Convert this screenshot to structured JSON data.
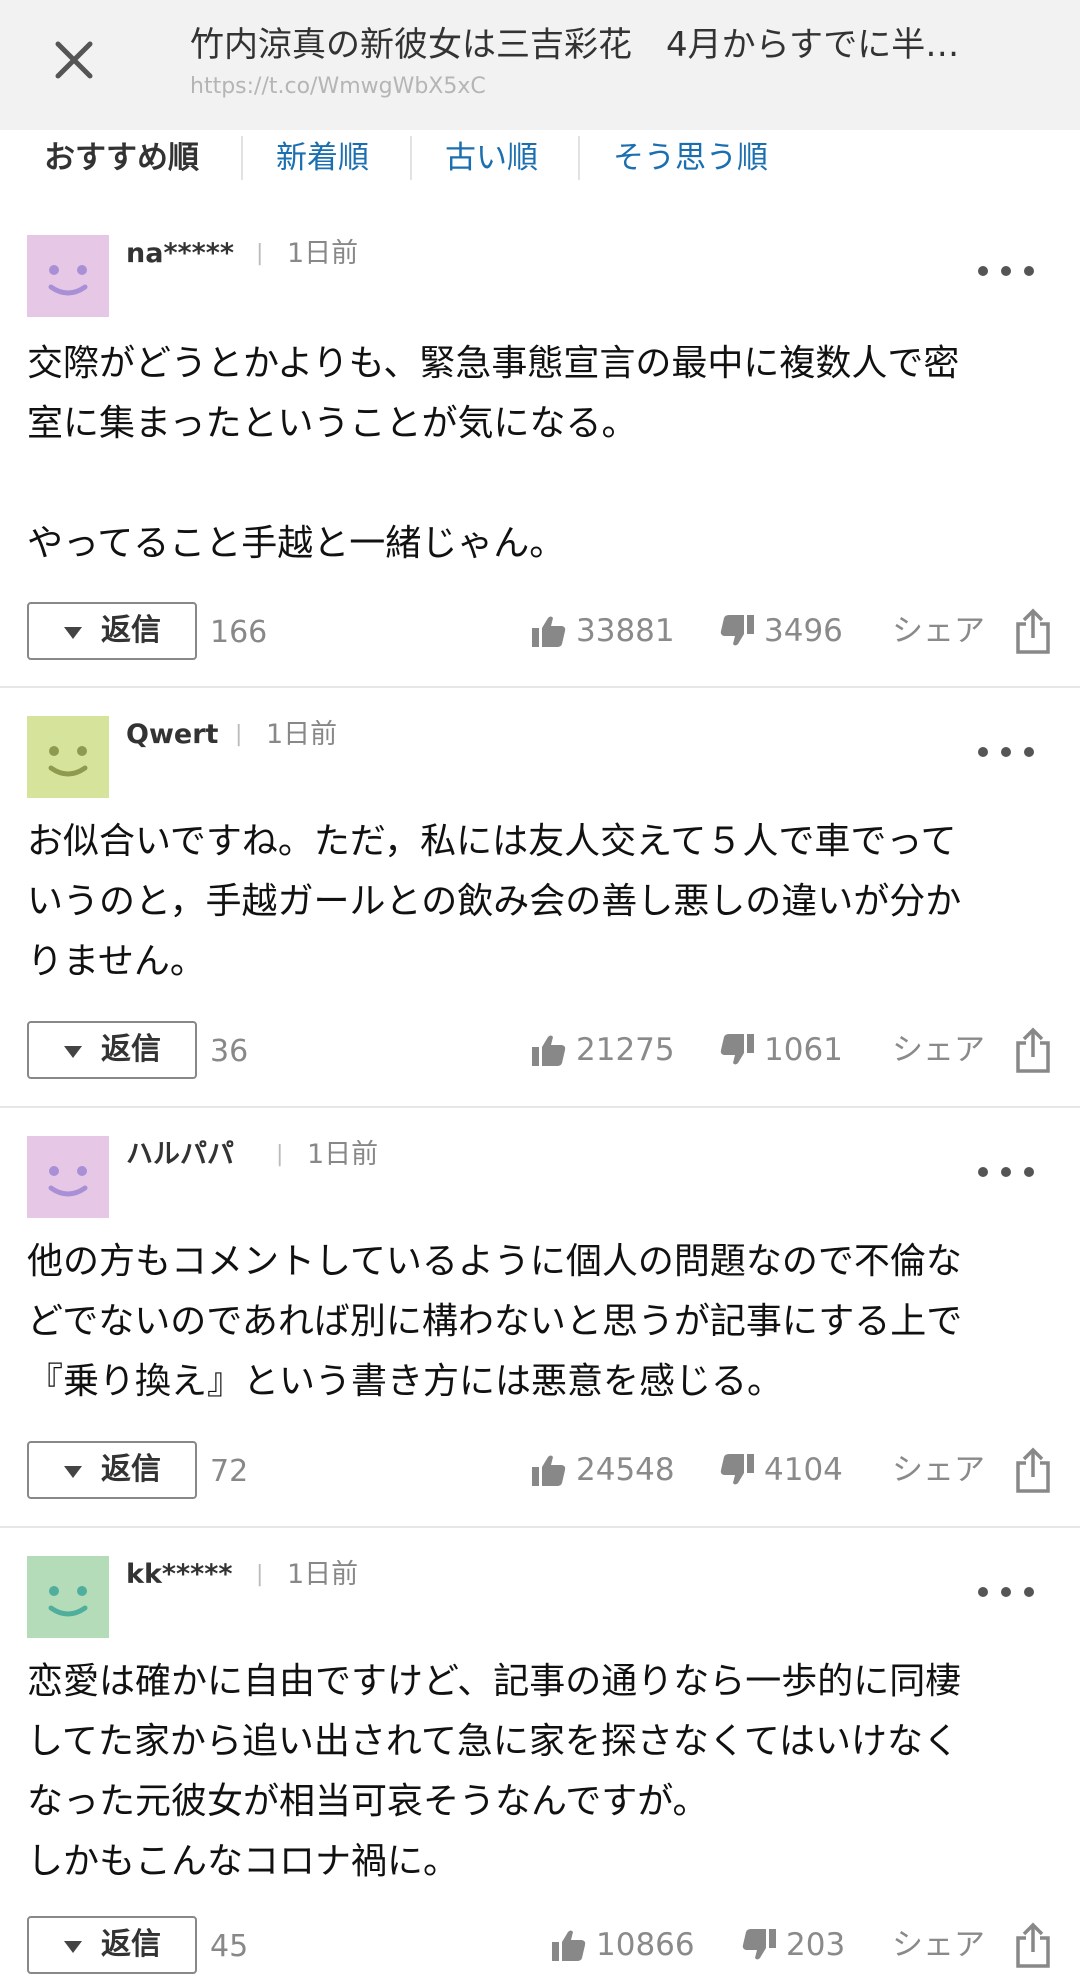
{
  "header": {
    "title": "竹内涼真の新彼女は三吉彩花　4月からすでに半…",
    "url": "https://t.co/WmwgWbX5xC"
  },
  "tabs": [
    {
      "label": "おすすめ順",
      "active": true
    },
    {
      "label": "新着順",
      "active": false
    },
    {
      "label": "古い順",
      "active": false
    },
    {
      "label": "そう思う順",
      "active": false
    }
  ],
  "reply_label": "返信",
  "share_label": "シェア",
  "colors": {
    "accent_link": "#1b6fb0",
    "avatar_purple": "#e6c8e6",
    "avatar_green_yellow": "#d6e39a",
    "avatar_mint": "#b5dcb9"
  },
  "comments": [
    {
      "user": "na*****",
      "time": "1日前",
      "avatar_color": "#e6c8e6",
      "avatar_face": "#a98fd6",
      "body": "交際がどうとかよりも、緊急事態宣言の最中に複数人で密\n室に集まったということが気になる。\n\nやってること手越と一緒じゃん。",
      "reply_count": "166",
      "likes": "33881",
      "dislikes": "3496"
    },
    {
      "user": "Qwert",
      "time": "1日前",
      "avatar_color": "#d6e39a",
      "avatar_face": "#8e9a50",
      "body": "お似合いですね。ただ，私には友人交えて５人で車でって\nいうのと，手越ガールとの飲み会の善し悪しの違いが分か\nりません。",
      "reply_count": "36",
      "likes": "21275",
      "dislikes": "1061"
    },
    {
      "user": "ハルパパ",
      "time": "1日前",
      "avatar_color": "#e6c8e6",
      "avatar_face": "#a98fd6",
      "body": "他の方もコメントしているように個人の問題なので不倫な\nどでないのであれば別に構わないと思うが記事にする上で\n『乗り換え』という書き方には悪意を感じる。",
      "reply_count": "72",
      "likes": "24548",
      "dislikes": "4104"
    },
    {
      "user": "kk*****",
      "time": "1日前",
      "avatar_color": "#b5dcb9",
      "avatar_face": "#4fae9c",
      "body": "恋愛は確かに自由ですけど、記事の通りなら一歩的に同棲\nしてた家から追い出されて急に家を探さなくてはいけなく\nなった元彼女が相当可哀そうなんですが。\nしかもこんなコロナ禍に。",
      "reply_count": "45",
      "likes": "10866",
      "dislikes": "203"
    }
  ]
}
